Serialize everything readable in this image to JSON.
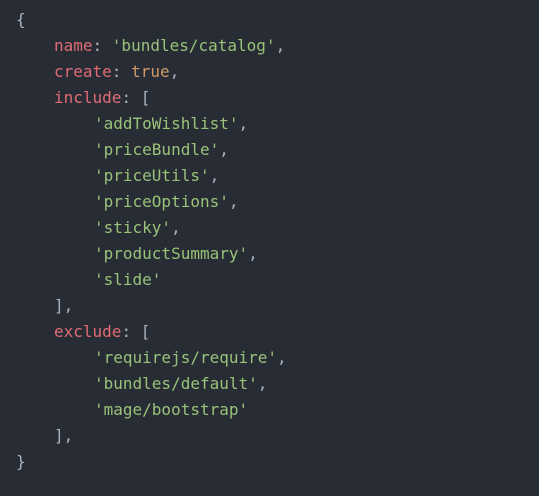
{
  "colors": {
    "background": "#282c34",
    "punctuation": "#abb2bf",
    "key": "#e06c75",
    "string": "#98c379",
    "boolean": "#d19a66"
  },
  "code": {
    "open_brace": "{",
    "close_brace": "}",
    "name": {
      "key": "name",
      "value": "'bundles/catalog'"
    },
    "create": {
      "key": "create",
      "value": "true"
    },
    "include": {
      "key": "include",
      "items": [
        "'addToWishlist'",
        "'priceBundle'",
        "'priceUtils'",
        "'priceOptions'",
        "'sticky'",
        "'productSummary'",
        "'slide'"
      ]
    },
    "exclude": {
      "key": "exclude",
      "items": [
        "'requirejs/require'",
        "'bundles/default'",
        "'mage/bootstrap'"
      ]
    }
  }
}
